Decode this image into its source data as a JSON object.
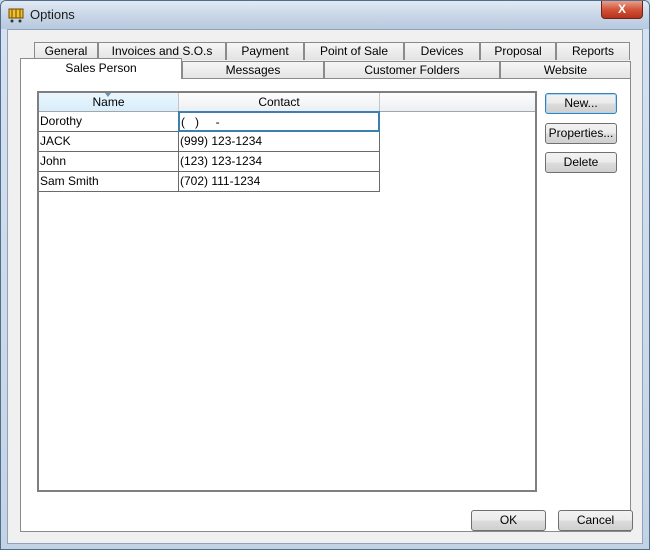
{
  "window": {
    "title": "Options",
    "close_label": "X"
  },
  "tabs_back": [
    "General",
    "Invoices and S.O.s",
    "Payment",
    "Point of Sale",
    "Devices",
    "Proposal",
    "Reports"
  ],
  "tabs_front": [
    "Sales Person",
    "Messages",
    "Customer Folders",
    "Website"
  ],
  "active_tab": "Sales Person",
  "grid": {
    "columns": [
      "Name",
      "Contact"
    ],
    "rows": [
      {
        "name": "Dorothy",
        "contact": "(   )     -"
      },
      {
        "name": "JACK",
        "contact": "(999) 123-1234"
      },
      {
        "name": "John",
        "contact": "(123) 123-1234"
      },
      {
        "name": "Sam Smith",
        "contact": "(702) 111-1234"
      }
    ]
  },
  "buttons": {
    "new_label": "New...",
    "properties_label": "Properties...",
    "delete_label": "Delete",
    "ok_label": "OK",
    "cancel_label": "Cancel"
  }
}
